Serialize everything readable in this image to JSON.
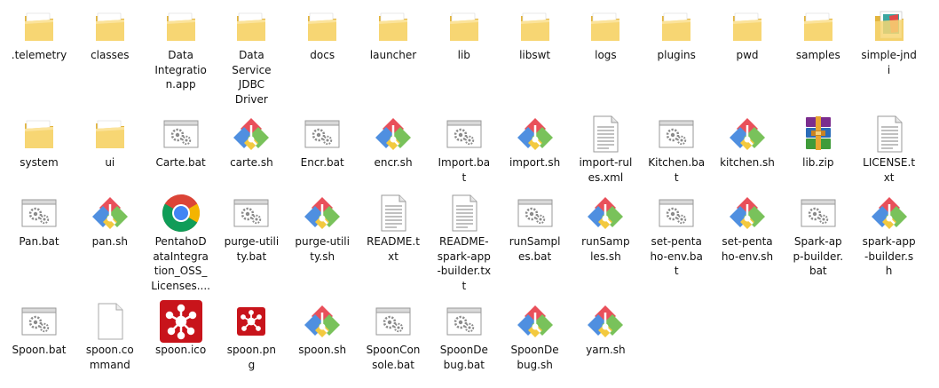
{
  "window": {
    "view": "Large icons"
  },
  "files": [
    {
      "name": ".telemetry",
      "icon": "folder-icon"
    },
    {
      "name": "classes",
      "icon": "folder-icon"
    },
    {
      "name": "Data Integration.app",
      "display": "Data\nIntegratio\nn.app",
      "icon": "folder-icon"
    },
    {
      "name": "Data Service JDBC Driver",
      "display": "Data\nService\nJDBC\nDriver",
      "icon": "folder-icon"
    },
    {
      "name": "docs",
      "icon": "folder-icon"
    },
    {
      "name": "launcher",
      "icon": "folder-icon"
    },
    {
      "name": "lib",
      "icon": "folder-icon"
    },
    {
      "name": "libswt",
      "icon": "folder-icon"
    },
    {
      "name": "logs",
      "icon": "folder-icon"
    },
    {
      "name": "plugins",
      "icon": "folder-icon"
    },
    {
      "name": "pwd",
      "icon": "folder-icon"
    },
    {
      "name": "samples",
      "icon": "folder-icon"
    },
    {
      "name": "simple-jndi",
      "display": "simple-jnd\ni",
      "icon": "folder-image-icon"
    },
    {
      "name": "system",
      "icon": "folder-icon"
    },
    {
      "name": "ui",
      "icon": "folder-icon"
    },
    {
      "name": "Carte.bat",
      "icon": "batch-file-icon"
    },
    {
      "name": "carte.sh",
      "icon": "shell-script-icon"
    },
    {
      "name": "Encr.bat",
      "icon": "batch-file-icon"
    },
    {
      "name": "encr.sh",
      "icon": "shell-script-icon"
    },
    {
      "name": "Import.bat",
      "display": "Import.ba\nt",
      "icon": "batch-file-icon"
    },
    {
      "name": "import.sh",
      "icon": "shell-script-icon"
    },
    {
      "name": "import-rules.xml",
      "display": "import-rul\nes.xml",
      "icon": "text-file-icon"
    },
    {
      "name": "Kitchen.bat",
      "display": "Kitchen.ba\nt",
      "icon": "batch-file-icon"
    },
    {
      "name": "kitchen.sh",
      "icon": "shell-script-icon"
    },
    {
      "name": "lib.zip",
      "icon": "winrar-archive-icon"
    },
    {
      "name": "LICENSE.txt",
      "display": "LICENSE.t\nxt",
      "icon": "text-file-icon"
    },
    {
      "name": "Pan.bat",
      "icon": "batch-file-icon"
    },
    {
      "name": "pan.sh",
      "icon": "shell-script-icon"
    },
    {
      "name": "PentahoDataIntegration_OSS_Licenses....",
      "display": "PentahoD\nataIntegra\ntion_OSS_\nLicenses....",
      "icon": "chrome-icon"
    },
    {
      "name": "purge-utility.bat",
      "display": "purge-utili\nty.bat",
      "icon": "batch-file-icon"
    },
    {
      "name": "purge-utility.sh",
      "display": "purge-utili\nty.sh",
      "icon": "shell-script-icon"
    },
    {
      "name": "README.txt",
      "display": "README.t\nxt",
      "icon": "text-file-icon"
    },
    {
      "name": "README-spark-app-builder.txt",
      "display": "README-\nspark-app\n-builder.tx\nt",
      "icon": "text-file-icon"
    },
    {
      "name": "runSamples.bat",
      "display": "runSampl\nes.bat",
      "icon": "batch-file-icon"
    },
    {
      "name": "runSamples.sh",
      "display": "runSamp\nles.sh",
      "icon": "shell-script-icon"
    },
    {
      "name": "set-pentaho-env.bat",
      "display": "set-penta\nho-env.ba\nt",
      "icon": "batch-file-icon"
    },
    {
      "name": "set-pentaho-env.sh",
      "display": "set-penta\nho-env.sh",
      "icon": "shell-script-icon"
    },
    {
      "name": "Spark-app-builder.bat",
      "display": "Spark-ap\np-builder.\nbat",
      "icon": "batch-file-icon"
    },
    {
      "name": "spark-app-builder.sh",
      "display": "spark-app\n-builder.s\nh",
      "icon": "shell-script-icon"
    },
    {
      "name": "Spoon.bat",
      "icon": "batch-file-icon"
    },
    {
      "name": "spoon.command",
      "display": "spoon.co\nmmand",
      "icon": "blank-file-icon"
    },
    {
      "name": "spoon.ico",
      "icon": "pentaho-ico-icon"
    },
    {
      "name": "spoon.png",
      "display": "spoon.pn\ng",
      "icon": "pentaho-png-icon"
    },
    {
      "name": "spoon.sh",
      "icon": "shell-script-icon"
    },
    {
      "name": "SpoonConsole.bat",
      "display": "SpoonCon\nsole.bat",
      "icon": "batch-file-icon"
    },
    {
      "name": "SpoonDebug.bat",
      "display": "SpoonDe\nbug.bat",
      "icon": "batch-file-icon"
    },
    {
      "name": "SpoonDebug.sh",
      "display": "SpoonDe\nbug.sh",
      "icon": "shell-script-icon"
    },
    {
      "name": "yarn.sh",
      "icon": "shell-script-icon"
    }
  ],
  "colors": {
    "folder": "#f7d673",
    "folder_dark": "#e3b53d",
    "sh_blue": "#4f8fe0",
    "sh_red": "#e9505a",
    "sh_green": "#79c25b",
    "sh_yellow": "#f3c93f",
    "pentaho_red": "#c8141b"
  }
}
